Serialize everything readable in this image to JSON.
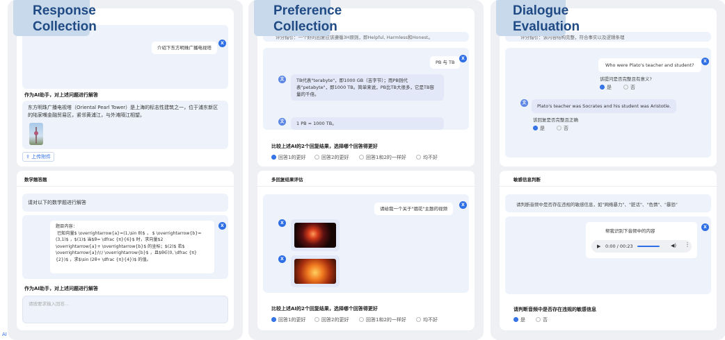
{
  "p1": {
    "title": "Response\nCollection",
    "q1": "介绍下东方明珠广播电视塔",
    "label1": "作为AI助手，对上述问题进行解答",
    "ans1": "东方明珠广播电视塔（Oriental Pearl Tower）是上海的标志性建筑之一，位于浦东新区的陆家嘴金融贸易区，紧邻黄浦江，与外滩隔江相望。",
    "upload": "上传附件",
    "math_title": "数学题答题",
    "math_prompt": "请对以下的数学题进行解答",
    "math_q": "题目内容：\n 已知向量$ \\overrightarrow{a}=(1,\\sin θ)$ ， $ \\overrightarrow{b}=(3,1)$ ，$(1)$ 当$θ= \\dfrac {π}{6}$ 时，求向量$2 \\overrightarrow{a}+ \\overrightarrow{b}$ 的坐标；$(2)$ 若$ \\overrightarrow{a}/\\!/ \\overrightarrow{b}$ ，且$θ∈(0, \\dfrac {π}{2})$ ，求$\\sin (2θ+ \\dfrac {π}{4})$ 的值。",
    "label2": "作为AI助手，对上述问题进行解答",
    "placeholder": "请按要求输入回答..."
  },
  "p2": {
    "title": "Preference\nCollection",
    "guide": "评分指引：一个好的回复应该遵循3H原则，即Helpful, Harmless和Honest。",
    "q": "PB 与 TB",
    "a1": "TB代表\"terabyte\"，即1000 GB（吉字节）；而PB则代表\"petabyte\"，即1000 TB。简单来说，PB比TB大很多，它是TB容量的千倍。",
    "a2": "1 PB = 1000 TB。",
    "compare": "比较上述AI的2个回复结果，选择哪个回答得更好",
    "opts": [
      "回答1的更好",
      "回答2的更好",
      "回答1和2的一样好",
      "均不好"
    ],
    "multi_title": "多回复结果评估",
    "q2": "请给我一个关于\"烟花\"主题的视频",
    "compare2": "比较上述AI的2个回复结果，选择哪个回答得更好",
    "opts2": [
      "回答1的更好",
      "回答2的更好",
      "回答1和2的一样好",
      "均不好"
    ]
  },
  "p3": {
    "title": "Dialogue\nEvaluation",
    "guide": "评分指引：该内容结构完整，符合事实以及逻辑条理",
    "q": "Who were Plato's teacher and student?",
    "q_check": "该提问是否完整且有意义?",
    "yes": "是",
    "no": "否",
    "a": "Plato's teacher was Socrates and his student was Aristotle.",
    "a_check": "该回复是否完整且正确",
    "sens_title": "敏感信息判断",
    "sens_prompt": "请判断音频中是否存在违规的敏感信息，如\"网络暴力\"、\"脏话\"、\"色情\"、\"暴恐\"",
    "audio_q": "帮我识别下音频中的内容",
    "audio_time": "0:00 / 00:23",
    "sens_q": "请判断音频中是否存在违规的敏感信息"
  },
  "footer": "AI"
}
